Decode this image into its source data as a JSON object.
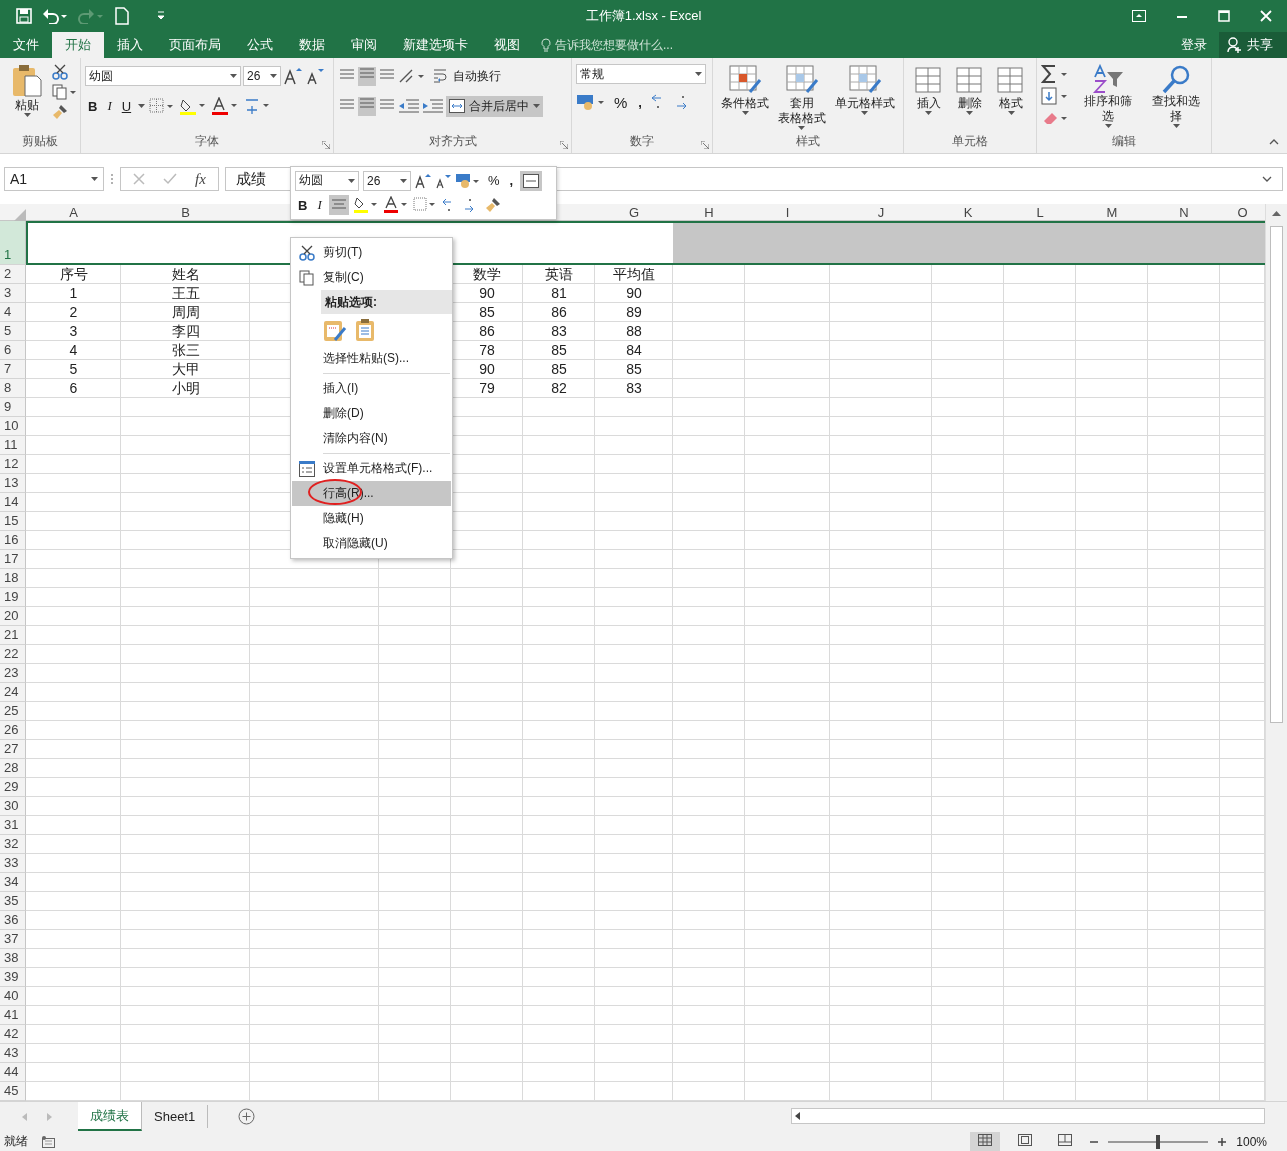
{
  "window": {
    "title": "工作簿1.xlsx - Excel"
  },
  "menu_tabs": [
    {
      "label": "文件",
      "selected": false
    },
    {
      "label": "开始",
      "selected": true
    },
    {
      "label": "插入",
      "selected": false
    },
    {
      "label": "页面布局",
      "selected": false
    },
    {
      "label": "公式",
      "selected": false
    },
    {
      "label": "数据",
      "selected": false
    },
    {
      "label": "审阅",
      "selected": false
    },
    {
      "label": "新建选项卡",
      "selected": false
    },
    {
      "label": "视图",
      "selected": false
    }
  ],
  "tell_me": {
    "placeholder": "告诉我您想要做什么..."
  },
  "account": {
    "sign_in": "登录",
    "share": "共享"
  },
  "ribbon": {
    "clipboard": {
      "paste": "粘贴",
      "label": "剪贴板"
    },
    "font": {
      "name": "幼圆",
      "size": "26",
      "bold": "B",
      "italic": "I",
      "underline": "U",
      "label": "字体"
    },
    "alignment": {
      "wrap": "自动换行",
      "merge": {
        "label": "合并后居中",
        "selected": true
      },
      "label": "对齐方式"
    },
    "number": {
      "format": "常规",
      "percent": "%",
      "comma": ",",
      "label": "数字"
    },
    "styles": {
      "buttons": [
        {
          "lines": [
            "条件格式"
          ]
        },
        {
          "lines": [
            "套用",
            "表格格式"
          ]
        },
        {
          "lines": [
            "单元格样式"
          ]
        }
      ],
      "label": "样式"
    },
    "cells": {
      "buttons": [
        "插入",
        "删除",
        "格式"
      ],
      "label": "单元格"
    },
    "editing": {
      "buttons": [
        "排序和筛选",
        "查找和选择"
      ],
      "label": "编辑"
    }
  },
  "name_box": {
    "value": "A1"
  },
  "formula_bar": {
    "function_label": "fx",
    "value": "成绩"
  },
  "mini_toolbar": {
    "font": "幼圆",
    "size": "26",
    "percent": "%",
    "comma": ",",
    "bold": "B",
    "italic": "I"
  },
  "columns": [
    "A",
    "B",
    null,
    null,
    null,
    null,
    "G",
    "H",
    "I",
    "J",
    "K",
    "L",
    "M",
    "N",
    "O"
  ],
  "rows": [
    {
      "number": "1",
      "selected": true,
      "kind": "merged"
    },
    {
      "number": "2",
      "selected": false,
      "cells": [
        "序号",
        "姓名",
        null,
        null,
        "数学",
        "英语",
        "平均值"
      ]
    },
    {
      "number": "3",
      "selected": false,
      "cells": [
        "1",
        "王五",
        null,
        null,
        "90",
        "81",
        "90"
      ]
    },
    {
      "number": "4",
      "selected": false,
      "cells": [
        "2",
        "周周",
        null,
        null,
        "85",
        "86",
        "89"
      ]
    },
    {
      "number": "5",
      "selected": false,
      "cells": [
        "3",
        "李四",
        null,
        null,
        "86",
        "83",
        "88"
      ]
    },
    {
      "number": "6",
      "selected": false,
      "cells": [
        "4",
        "张三",
        null,
        null,
        "78",
        "85",
        "84"
      ]
    },
    {
      "number": "7",
      "selected": false,
      "cells": [
        "5",
        "大甲",
        null,
        null,
        "90",
        "85",
        "85"
      ]
    },
    {
      "number": "8",
      "selected": false,
      "cells": [
        "6",
        "小明",
        null,
        null,
        "79",
        "82",
        "83"
      ]
    },
    {
      "number": "9",
      "selected": false
    },
    {
      "number": "10",
      "selected": false
    },
    {
      "number": "11",
      "selected": false
    },
    {
      "number": "12",
      "selected": false
    },
    {
      "number": "13",
      "selected": false
    },
    {
      "number": "14",
      "selected": false
    },
    {
      "number": "15",
      "selected": false
    },
    {
      "number": "16",
      "selected": false
    },
    {
      "number": "17",
      "selected": false
    },
    {
      "number": "18",
      "selected": false
    },
    {
      "number": "19",
      "selected": false
    },
    {
      "number": "20",
      "selected": false
    },
    {
      "number": "21",
      "selected": false
    },
    {
      "number": "22",
      "selected": false
    },
    {
      "number": "23",
      "selected": false
    },
    {
      "number": "24",
      "selected": false
    },
    {
      "number": "25",
      "selected": false
    },
    {
      "number": "26",
      "selected": false
    },
    {
      "number": "27",
      "selected": false
    },
    {
      "number": "28",
      "selected": false
    },
    {
      "number": "29",
      "selected": false
    },
    {
      "number": "30",
      "selected": false
    },
    {
      "number": "31",
      "selected": false
    },
    {
      "number": "32",
      "selected": false
    },
    {
      "number": "33",
      "selected": false
    },
    {
      "number": "34",
      "selected": false
    },
    {
      "number": "35",
      "selected": false
    },
    {
      "number": "36",
      "selected": false
    },
    {
      "number": "37",
      "selected": false
    },
    {
      "number": "38",
      "selected": false
    },
    {
      "number": "39",
      "selected": false
    },
    {
      "number": "40",
      "selected": false
    },
    {
      "number": "41",
      "selected": false
    },
    {
      "number": "42",
      "selected": false
    },
    {
      "number": "43",
      "selected": false
    },
    {
      "number": "44",
      "selected": false
    },
    {
      "number": "45",
      "selected": false
    }
  ],
  "context_menu": [
    {
      "kind": "cut",
      "label": "剪切(T)",
      "selected": false
    },
    {
      "kind": "copy",
      "label": "复制(C)",
      "selected": false
    },
    {
      "kind": "header",
      "label": "粘贴选项:"
    },
    {
      "kind": "paste"
    },
    {
      "kind": "command",
      "label": "选择性粘贴(S)...",
      "selected": false
    },
    {
      "kind": "separator"
    },
    {
      "kind": "command",
      "label": "插入(I)",
      "selected": false
    },
    {
      "kind": "command",
      "label": "删除(D)",
      "selected": false
    },
    {
      "kind": "command",
      "label": "清除内容(N)",
      "selected": false
    },
    {
      "kind": "separator"
    },
    {
      "kind": "format",
      "label": "设置单元格格式(F)...",
      "selected": false
    },
    {
      "kind": "command",
      "label": "行高(R)...",
      "selected": true
    },
    {
      "kind": "command",
      "label": "隐藏(H)",
      "selected": false
    },
    {
      "kind": "command",
      "label": "取消隐藏(U)",
      "selected": false
    }
  ],
  "sheet_tabs": [
    {
      "label": "成绩表",
      "selected": true
    },
    {
      "label": "Sheet1",
      "selected": false
    }
  ],
  "status_bar": {
    "text": "就绪",
    "zoom": "100%",
    "zoom_slider": {
      "level": 0.5
    }
  }
}
